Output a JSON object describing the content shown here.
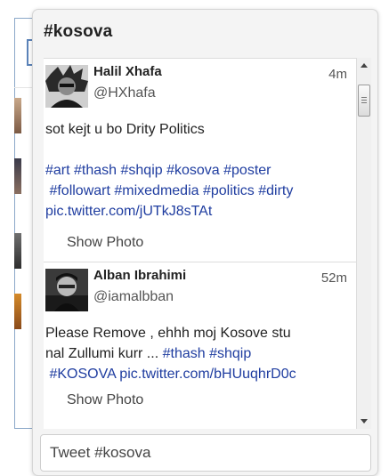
{
  "popup": {
    "title": "#kosova",
    "input_placeholder": "Tweet #kosova"
  },
  "tweets": [
    {
      "author": "Halil Xhafa",
      "handle": "@HXhafa",
      "time": "4m",
      "text_plain": "sot kejt u bo Drity Politics",
      "hashtags_line1": "#art #thash #shqip #kosova #poster",
      "hashtags_line2": " #followart #mixedmedia #politics #dirty",
      "link": "pic.twitter.com/jUTkJ8sTAt",
      "show_photo": "Show Photo",
      "avatar_icon": "person-photo-icon"
    },
    {
      "author": "Alban Ibrahimi",
      "handle": "@iamalbban",
      "time": "52m",
      "text_line1": "Please Remove , ehhh moj Kosove stu",
      "text_line2_plain": "nal Zullumi kurr ... ",
      "text_line2_tags": "#thash #shqip",
      "text_line3_tag": " #KOSOVA",
      "text_line3_link": " pic.twitter.com/bHUuqhrD0c",
      "show_photo": "Show Photo",
      "avatar_icon": "person-photo-icon"
    }
  ],
  "colors": {
    "link": "#1f3da0",
    "text": "#222222",
    "popup_bg": "#f4f4f4"
  }
}
